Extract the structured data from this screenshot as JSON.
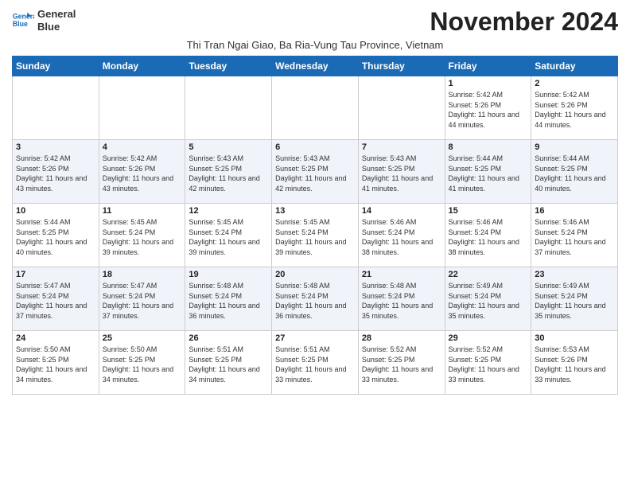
{
  "header": {
    "logo_line1": "General",
    "logo_line2": "Blue",
    "month_title": "November 2024",
    "subtitle": "Thi Tran Ngai Giao, Ba Ria-Vung Tau Province, Vietnam"
  },
  "weekdays": [
    "Sunday",
    "Monday",
    "Tuesday",
    "Wednesday",
    "Thursday",
    "Friday",
    "Saturday"
  ],
  "weeks": [
    [
      {
        "day": "",
        "info": ""
      },
      {
        "day": "",
        "info": ""
      },
      {
        "day": "",
        "info": ""
      },
      {
        "day": "",
        "info": ""
      },
      {
        "day": "",
        "info": ""
      },
      {
        "day": "1",
        "info": "Sunrise: 5:42 AM\nSunset: 5:26 PM\nDaylight: 11 hours and 44 minutes."
      },
      {
        "day": "2",
        "info": "Sunrise: 5:42 AM\nSunset: 5:26 PM\nDaylight: 11 hours and 44 minutes."
      }
    ],
    [
      {
        "day": "3",
        "info": "Sunrise: 5:42 AM\nSunset: 5:26 PM\nDaylight: 11 hours and 43 minutes."
      },
      {
        "day": "4",
        "info": "Sunrise: 5:42 AM\nSunset: 5:26 PM\nDaylight: 11 hours and 43 minutes."
      },
      {
        "day": "5",
        "info": "Sunrise: 5:43 AM\nSunset: 5:25 PM\nDaylight: 11 hours and 42 minutes."
      },
      {
        "day": "6",
        "info": "Sunrise: 5:43 AM\nSunset: 5:25 PM\nDaylight: 11 hours and 42 minutes."
      },
      {
        "day": "7",
        "info": "Sunrise: 5:43 AM\nSunset: 5:25 PM\nDaylight: 11 hours and 41 minutes."
      },
      {
        "day": "8",
        "info": "Sunrise: 5:44 AM\nSunset: 5:25 PM\nDaylight: 11 hours and 41 minutes."
      },
      {
        "day": "9",
        "info": "Sunrise: 5:44 AM\nSunset: 5:25 PM\nDaylight: 11 hours and 40 minutes."
      }
    ],
    [
      {
        "day": "10",
        "info": "Sunrise: 5:44 AM\nSunset: 5:25 PM\nDaylight: 11 hours and 40 minutes."
      },
      {
        "day": "11",
        "info": "Sunrise: 5:45 AM\nSunset: 5:24 PM\nDaylight: 11 hours and 39 minutes."
      },
      {
        "day": "12",
        "info": "Sunrise: 5:45 AM\nSunset: 5:24 PM\nDaylight: 11 hours and 39 minutes."
      },
      {
        "day": "13",
        "info": "Sunrise: 5:45 AM\nSunset: 5:24 PM\nDaylight: 11 hours and 39 minutes."
      },
      {
        "day": "14",
        "info": "Sunrise: 5:46 AM\nSunset: 5:24 PM\nDaylight: 11 hours and 38 minutes."
      },
      {
        "day": "15",
        "info": "Sunrise: 5:46 AM\nSunset: 5:24 PM\nDaylight: 11 hours and 38 minutes."
      },
      {
        "day": "16",
        "info": "Sunrise: 5:46 AM\nSunset: 5:24 PM\nDaylight: 11 hours and 37 minutes."
      }
    ],
    [
      {
        "day": "17",
        "info": "Sunrise: 5:47 AM\nSunset: 5:24 PM\nDaylight: 11 hours and 37 minutes."
      },
      {
        "day": "18",
        "info": "Sunrise: 5:47 AM\nSunset: 5:24 PM\nDaylight: 11 hours and 37 minutes."
      },
      {
        "day": "19",
        "info": "Sunrise: 5:48 AM\nSunset: 5:24 PM\nDaylight: 11 hours and 36 minutes."
      },
      {
        "day": "20",
        "info": "Sunrise: 5:48 AM\nSunset: 5:24 PM\nDaylight: 11 hours and 36 minutes."
      },
      {
        "day": "21",
        "info": "Sunrise: 5:48 AM\nSunset: 5:24 PM\nDaylight: 11 hours and 35 minutes."
      },
      {
        "day": "22",
        "info": "Sunrise: 5:49 AM\nSunset: 5:24 PM\nDaylight: 11 hours and 35 minutes."
      },
      {
        "day": "23",
        "info": "Sunrise: 5:49 AM\nSunset: 5:24 PM\nDaylight: 11 hours and 35 minutes."
      }
    ],
    [
      {
        "day": "24",
        "info": "Sunrise: 5:50 AM\nSunset: 5:25 PM\nDaylight: 11 hours and 34 minutes."
      },
      {
        "day": "25",
        "info": "Sunrise: 5:50 AM\nSunset: 5:25 PM\nDaylight: 11 hours and 34 minutes."
      },
      {
        "day": "26",
        "info": "Sunrise: 5:51 AM\nSunset: 5:25 PM\nDaylight: 11 hours and 34 minutes."
      },
      {
        "day": "27",
        "info": "Sunrise: 5:51 AM\nSunset: 5:25 PM\nDaylight: 11 hours and 33 minutes."
      },
      {
        "day": "28",
        "info": "Sunrise: 5:52 AM\nSunset: 5:25 PM\nDaylight: 11 hours and 33 minutes."
      },
      {
        "day": "29",
        "info": "Sunrise: 5:52 AM\nSunset: 5:25 PM\nDaylight: 11 hours and 33 minutes."
      },
      {
        "day": "30",
        "info": "Sunrise: 5:53 AM\nSunset: 5:26 PM\nDaylight: 11 hours and 33 minutes."
      }
    ]
  ]
}
